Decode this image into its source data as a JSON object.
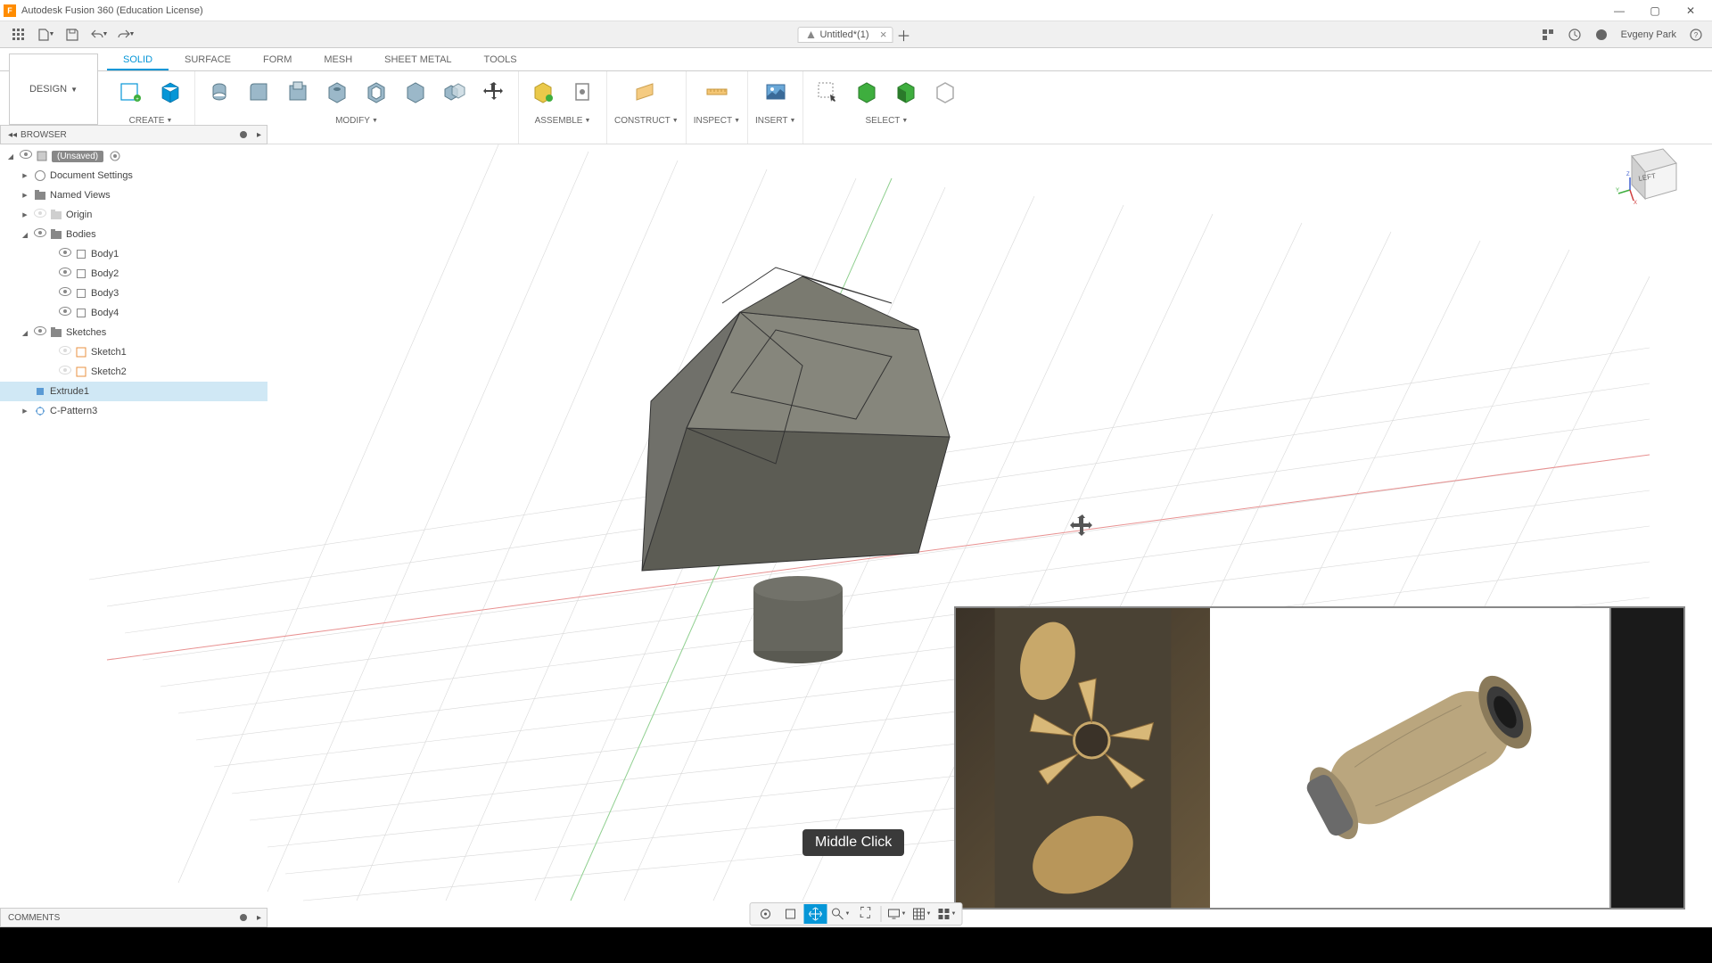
{
  "app": {
    "title": "Autodesk Fusion 360 (Education License)"
  },
  "user": {
    "name": "Evgeny Park"
  },
  "document": {
    "tab_title": "Untitled*(1)"
  },
  "workspace": {
    "label": "DESIGN"
  },
  "ribbon_tabs": {
    "solid": "SOLID",
    "surface": "SURFACE",
    "form": "FORM",
    "mesh": "MESH",
    "sheet_metal": "SHEET METAL",
    "tools": "TOOLS"
  },
  "ribbon_groups": {
    "create": "CREATE",
    "modify": "MODIFY",
    "assemble": "ASSEMBLE",
    "construct": "CONSTRUCT",
    "inspect": "INSPECT",
    "insert": "INSERT",
    "select": "SELECT"
  },
  "browser": {
    "title": "BROWSER",
    "root": "(Unsaved)",
    "document_settings": "Document Settings",
    "named_views": "Named Views",
    "origin": "Origin",
    "bodies": "Bodies",
    "body1": "Body1",
    "body2": "Body2",
    "body3": "Body3",
    "body4": "Body4",
    "sketches": "Sketches",
    "sketch1": "Sketch1",
    "sketch2": "Sketch2",
    "extrude1": "Extrude1",
    "cpattern3": "C-Pattern3"
  },
  "comments": {
    "title": "COMMENTS"
  },
  "viewcube": {
    "face": "LEFT"
  },
  "tooltip": {
    "text": "Middle Click"
  }
}
